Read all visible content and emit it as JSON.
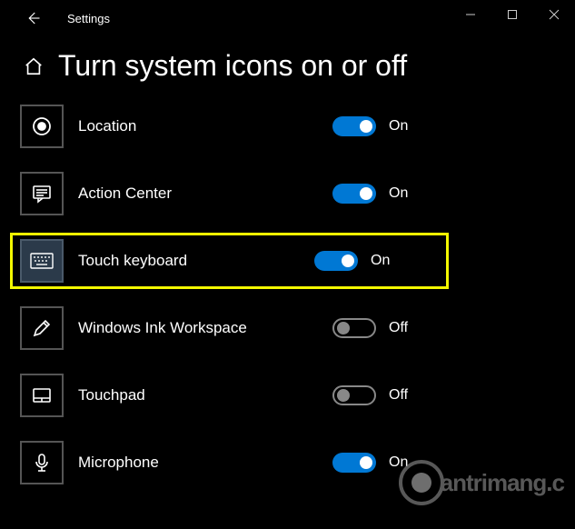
{
  "app": {
    "title": "Settings"
  },
  "page": {
    "title": "Turn system icons on or off"
  },
  "toggle_labels": {
    "on": "On",
    "off": "Off"
  },
  "items": [
    {
      "id": "location",
      "label": "Location",
      "state": "on",
      "icon": "location-icon"
    },
    {
      "id": "action-center",
      "label": "Action Center",
      "state": "on",
      "icon": "action-center-icon"
    },
    {
      "id": "touch-keyboard",
      "label": "Touch keyboard",
      "state": "on",
      "icon": "keyboard-icon",
      "highlighted": true
    },
    {
      "id": "windows-ink",
      "label": "Windows Ink Workspace",
      "state": "off",
      "icon": "pen-icon"
    },
    {
      "id": "touchpad",
      "label": "Touchpad",
      "state": "off",
      "icon": "touchpad-icon"
    },
    {
      "id": "microphone",
      "label": "Microphone",
      "state": "on",
      "icon": "microphone-icon"
    }
  ],
  "watermark": {
    "text": "antrimang.c"
  }
}
